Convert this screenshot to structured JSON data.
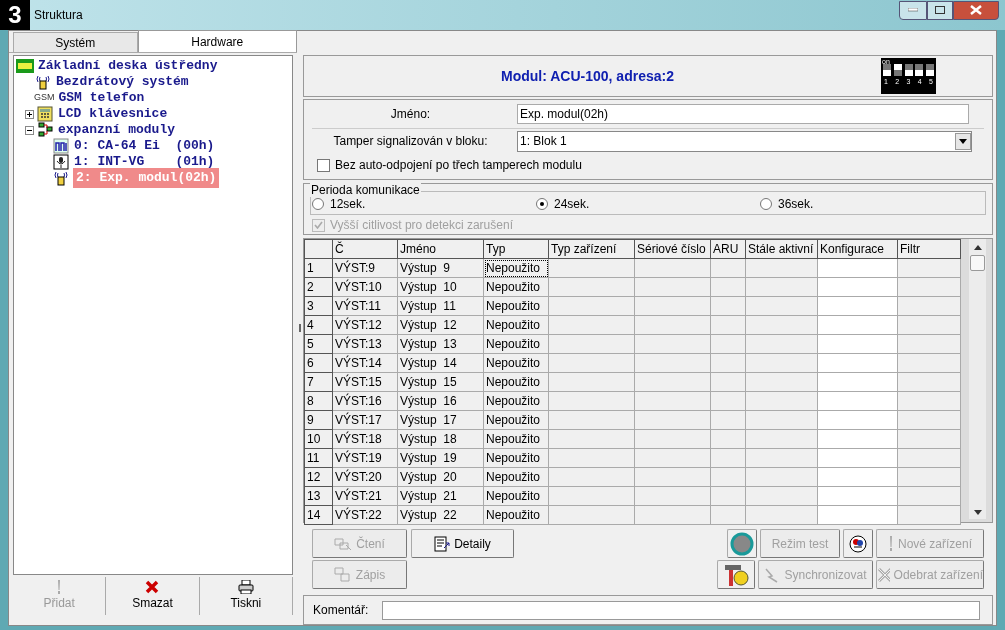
{
  "window": {
    "badge": "3",
    "title": "Struktura"
  },
  "left_tabs": [
    {
      "label": "Systém",
      "selected": false
    },
    {
      "label": "Hardware",
      "selected": true
    }
  ],
  "tree": [
    {
      "label": "Základní deska ústředny",
      "kind": "board",
      "selected": false,
      "children": [
        {
          "label": "Bezdrátový systém",
          "kind": "wireless",
          "selected": false
        },
        {
          "label": "GSM telefon",
          "kind": "gsm",
          "icon_text": "GSM",
          "selected": false
        },
        {
          "label": "LCD klávesnice",
          "kind": "keypad",
          "expanded": false,
          "selected": false
        },
        {
          "label": "expanzní moduly",
          "kind": "modules",
          "expanded": true,
          "selected": false,
          "children": [
            {
              "label": "0: CA-64 Ei  (00h)",
              "kind": "expander",
              "selected": false
            },
            {
              "label": "1: INT-VG    (01h)",
              "kind": "voice",
              "selected": false
            },
            {
              "label": "2: Exp. modul(02h)",
              "kind": "wireless",
              "selected": true
            }
          ]
        }
      ]
    }
  ],
  "left_buttons": [
    {
      "label": "Přidat",
      "kind": "add",
      "disabled": true
    },
    {
      "label": "Smazat",
      "kind": "delete",
      "disabled": false
    },
    {
      "label": "Tiskni",
      "kind": "print",
      "disabled": false
    }
  ],
  "header": {
    "title": "Modul: ACU-100, adresa:2",
    "dip": {
      "label": "on",
      "switches": [
        {
          "label": "1",
          "on": false
        },
        {
          "label": "2",
          "on": true
        },
        {
          "label": "3",
          "on": false
        },
        {
          "label": "4",
          "on": false
        },
        {
          "label": "5",
          "on": false
        }
      ]
    }
  },
  "name_field": {
    "label": "Jméno:",
    "value": "Exp. modul(02h)"
  },
  "tamper_field": {
    "label": "Tamper signalizován v bloku:",
    "value": "1: Blok  1"
  },
  "auto_disconnect": {
    "label": "Bez auto-odpojení po třech tamperech modulu",
    "checked": false,
    "disabled": false
  },
  "period": {
    "label": "Perioda komunikace",
    "options": [
      {
        "label": "12sek.",
        "selected": false
      },
      {
        "label": "24sek.",
        "selected": true
      },
      {
        "label": "36sek.",
        "selected": false
      }
    ]
  },
  "sensitivity": {
    "label": "Vyšší citlivost pro detekci zarušení",
    "checked": true,
    "disabled": true
  },
  "table": {
    "columns": [
      "",
      "Č",
      "Jméno",
      "Typ",
      "Typ zařízení",
      "Sériové číslo",
      "ARU",
      "Stále aktivní",
      "Konfigurace",
      "Filtr"
    ],
    "rows": [
      [
        "1",
        "VÝST:9",
        "Výstup  9",
        "Nepoužito"
      ],
      [
        "2",
        "VÝST:10",
        "Výstup  10",
        "Nepoužito"
      ],
      [
        "3",
        "VÝST:11",
        "Výstup  11",
        "Nepoužito"
      ],
      [
        "4",
        "VÝST:12",
        "Výstup  12",
        "Nepoužito"
      ],
      [
        "5",
        "VÝST:13",
        "Výstup  13",
        "Nepoužito"
      ],
      [
        "6",
        "VÝST:14",
        "Výstup  14",
        "Nepoužito"
      ],
      [
        "7",
        "VÝST:15",
        "Výstup  15",
        "Nepoužito"
      ],
      [
        "8",
        "VÝST:16",
        "Výstup  16",
        "Nepoužito"
      ],
      [
        "9",
        "VÝST:17",
        "Výstup  17",
        "Nepoužito"
      ],
      [
        "10",
        "VÝST:18",
        "Výstup  18",
        "Nepoužito"
      ],
      [
        "11",
        "VÝST:19",
        "Výstup  19",
        "Nepoužito"
      ],
      [
        "12",
        "VÝST:20",
        "Výstup  20",
        "Nepoužito"
      ],
      [
        "13",
        "VÝST:21",
        "Výstup  21",
        "Nepoužito"
      ],
      [
        "14",
        "VÝST:22",
        "Výstup  22",
        "Nepoužito"
      ]
    ]
  },
  "action_buttons": [
    {
      "label": "Čtení",
      "kind": "read",
      "disabled": true
    },
    {
      "label": "Detaily",
      "kind": "details",
      "disabled": false
    },
    {
      "kind": "status"
    },
    {
      "label": "Režim test",
      "kind": "test",
      "disabled": true
    },
    {
      "kind": "color"
    },
    {
      "label": "Nové zařízení",
      "kind": "new",
      "disabled": true
    },
    {
      "label": "Zápis",
      "kind": "write",
      "disabled": true
    },
    {
      "kind": "tools"
    },
    {
      "label": "Synchronizovat",
      "kind": "sync",
      "disabled": true
    },
    {
      "label": "Odebrat zařízení",
      "kind": "remove",
      "disabled": true
    }
  ],
  "comment": {
    "label": "Komentář:"
  }
}
